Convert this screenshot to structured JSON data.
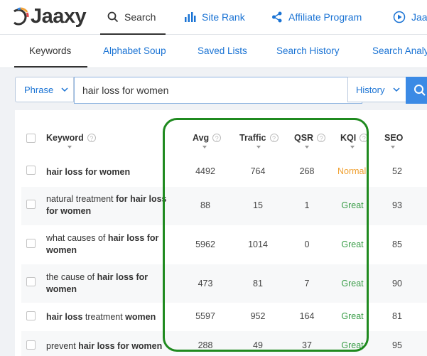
{
  "app": {
    "logo_text": "Jaaxy"
  },
  "nav": [
    {
      "label": "Search",
      "icon": "search-icon",
      "active": true
    },
    {
      "label": "Site Rank",
      "icon": "bar-chart-icon"
    },
    {
      "label": "Affiliate Program",
      "icon": "share-icon"
    },
    {
      "label": "Jaax",
      "icon": "play-circle-icon"
    }
  ],
  "subnav": [
    {
      "label": "Keywords",
      "active": true
    },
    {
      "label": "Alphabet Soup"
    },
    {
      "label": "Saved Lists"
    },
    {
      "label": "Search History"
    },
    {
      "label": "Search Analy"
    }
  ],
  "search": {
    "mode_label": "Phrase",
    "query": "hair loss for women",
    "history_label": "History"
  },
  "table": {
    "columns": [
      "Keyword",
      "Avg",
      "Traffic",
      "QSR",
      "KQI",
      "SEO"
    ],
    "rows": [
      {
        "kw_html": "<b>hair loss for women</b>",
        "avg": "4492",
        "traffic": "764",
        "qsr": "268",
        "kqi": "Normal",
        "kqi_kind": "normal",
        "seo": "52",
        "alt": false
      },
      {
        "kw_html": "natural treatment <b>for hair loss for women</b>",
        "avg": "88",
        "traffic": "15",
        "qsr": "1",
        "kqi": "Great",
        "kqi_kind": "great",
        "seo": "93",
        "alt": true
      },
      {
        "kw_html": "what causes of <b>hair loss for women</b>",
        "avg": "5962",
        "traffic": "1014",
        "qsr": "0",
        "kqi": "Great",
        "kqi_kind": "great",
        "seo": "85",
        "alt": false
      },
      {
        "kw_html": "the cause of <b>hair loss for women</b>",
        "avg": "473",
        "traffic": "81",
        "qsr": "7",
        "kqi": "Great",
        "kqi_kind": "great",
        "seo": "90",
        "alt": true
      },
      {
        "kw_html": "<b>hair loss</b> treatment <b>women</b>",
        "avg": "5597",
        "traffic": "952",
        "qsr": "164",
        "kqi": "Great",
        "kqi_kind": "great",
        "seo": "81",
        "alt": false
      },
      {
        "kw_html": "prevent <b>hair loss for women</b>",
        "avg": "288",
        "traffic": "49",
        "qsr": "37",
        "kqi": "Great",
        "kqi_kind": "great",
        "seo": "95",
        "alt": true
      }
    ]
  },
  "colors": {
    "accent": "#1a73d4",
    "great": "#3a9d48",
    "normal": "#f0a030",
    "highlight": "#1f8a1f"
  }
}
